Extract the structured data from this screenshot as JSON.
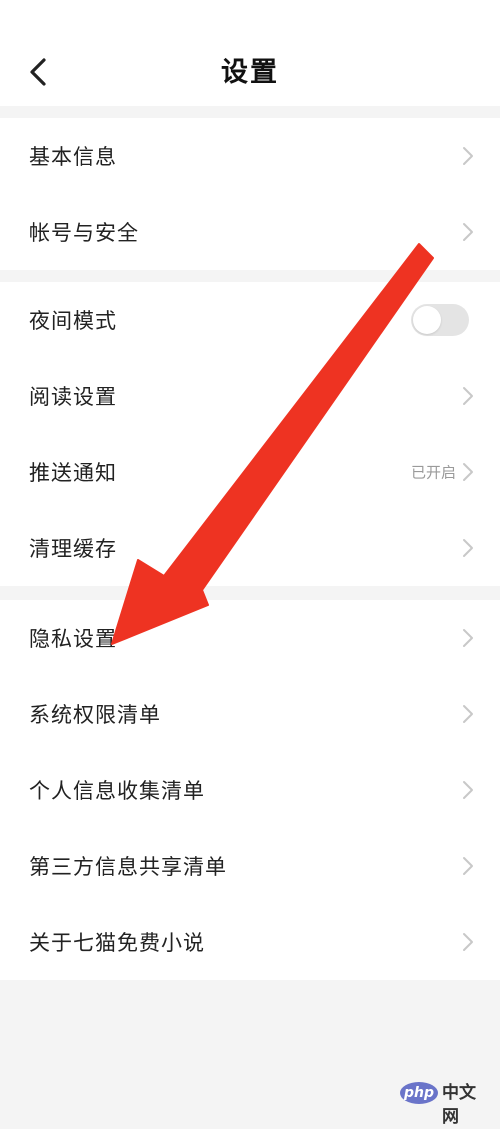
{
  "header": {
    "title": "设置"
  },
  "groups": [
    {
      "items": [
        {
          "label": "基本信息"
        },
        {
          "label": "帐号与安全"
        }
      ]
    },
    {
      "items": [
        {
          "label": "夜间模式",
          "toggle": false
        },
        {
          "label": "阅读设置"
        },
        {
          "label": "推送通知",
          "value": "已开启"
        },
        {
          "label": "清理缓存"
        }
      ]
    },
    {
      "items": [
        {
          "label": "隐私设置"
        },
        {
          "label": "系统权限清单"
        },
        {
          "label": "个人信息收集清单"
        },
        {
          "label": "第三方信息共享清单"
        },
        {
          "label": "关于七猫免费小说"
        }
      ]
    }
  ],
  "annotation": {
    "type": "arrow",
    "color": "#ee3322",
    "points_to": "隐私设置"
  },
  "watermark": {
    "logo_text": "php",
    "text": "中文网"
  },
  "colors": {
    "background": "#f4f4f4",
    "surface": "#ffffff",
    "text": "#222222",
    "secondary_text": "#9a9a9a",
    "chevron": "#c8c8c8",
    "toggle_off": "#e4e4e4",
    "arrow": "#ee3322"
  }
}
